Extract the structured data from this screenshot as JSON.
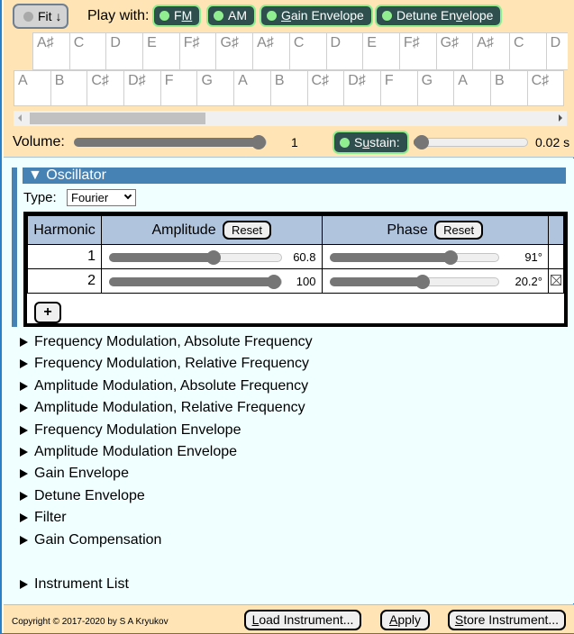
{
  "header": {
    "fit_button": "Fit ↓",
    "play_with_label": "Play with:",
    "play_buttons": [
      {
        "pre": "F",
        "u": "M",
        "post": ""
      },
      {
        "pre": "AM",
        "u": "",
        "post": ""
      },
      {
        "pre": "",
        "u": "G",
        "post": "ain Envelope"
      },
      {
        "pre": "Detune En",
        "u": "v",
        "post": "elope"
      }
    ]
  },
  "keyboard": {
    "upper_keys": [
      "A♯",
      "C",
      "D",
      "E",
      "F♯",
      "G♯",
      "A♯",
      "C",
      "D",
      "E",
      "F♯",
      "G♯",
      "A♯",
      "C",
      "D"
    ],
    "lower_keys": [
      "A",
      "B",
      "C♯",
      "D♯",
      "F",
      "G",
      "A",
      "B",
      "C♯",
      "D♯",
      "F",
      "G",
      "A",
      "B",
      "C♯"
    ],
    "scroll_fraction": 0.0
  },
  "volume": {
    "label": "Volume:",
    "value": "1",
    "fraction": 1.0
  },
  "sustain": {
    "pre": "S",
    "u": "u",
    "post": "stain:",
    "value": "0.02 s",
    "fraction": 0.0
  },
  "oscillator": {
    "title": "▼ Oscillator",
    "type_label": "Type:",
    "type_value": "Fourier",
    "columns": {
      "harmonic": "Harmonic",
      "amplitude": "Amplitude",
      "phase": "Phase",
      "reset": "Reset"
    },
    "rows": [
      {
        "harmonic": "1",
        "amplitude": "60.8",
        "amplitude_fraction": 0.608,
        "phase": "91°",
        "phase_fraction": 0.72,
        "deletable": false
      },
      {
        "harmonic": "2",
        "amplitude": "100",
        "amplitude_fraction": 1.0,
        "phase": "20.2°",
        "phase_fraction": 0.55,
        "deletable": true
      }
    ],
    "add_button": "+"
  },
  "sections": [
    "Frequency Modulation, Absolute Frequency",
    "Frequency Modulation, Relative Frequency",
    "Amplitude Modulation, Absolute Frequency",
    "Amplitude Modulation, Relative Frequency",
    "Frequency Modulation Envelope",
    "Amplitude Modulation Envelope",
    "Gain Envelope",
    "Detune Envelope",
    "Filter",
    "Gain Compensation"
  ],
  "instrument_list": "Instrument List",
  "footer": {
    "copyright": "Copyright © 2017-2020 by S A Kryukov",
    "load": {
      "u": "L",
      "post": "oad Instrument..."
    },
    "apply": {
      "u": "A",
      "post": "pply"
    },
    "store": {
      "u": "S",
      "post": "tore Instrument..."
    }
  },
  "colors": {
    "header_bg": "#ffe4b5",
    "main_bg": "#f0ffff",
    "accent": "#4682b4",
    "pill_bg": "#2f4f4f",
    "pill_border": "#90ee90",
    "table_header": "#b0c4de"
  }
}
